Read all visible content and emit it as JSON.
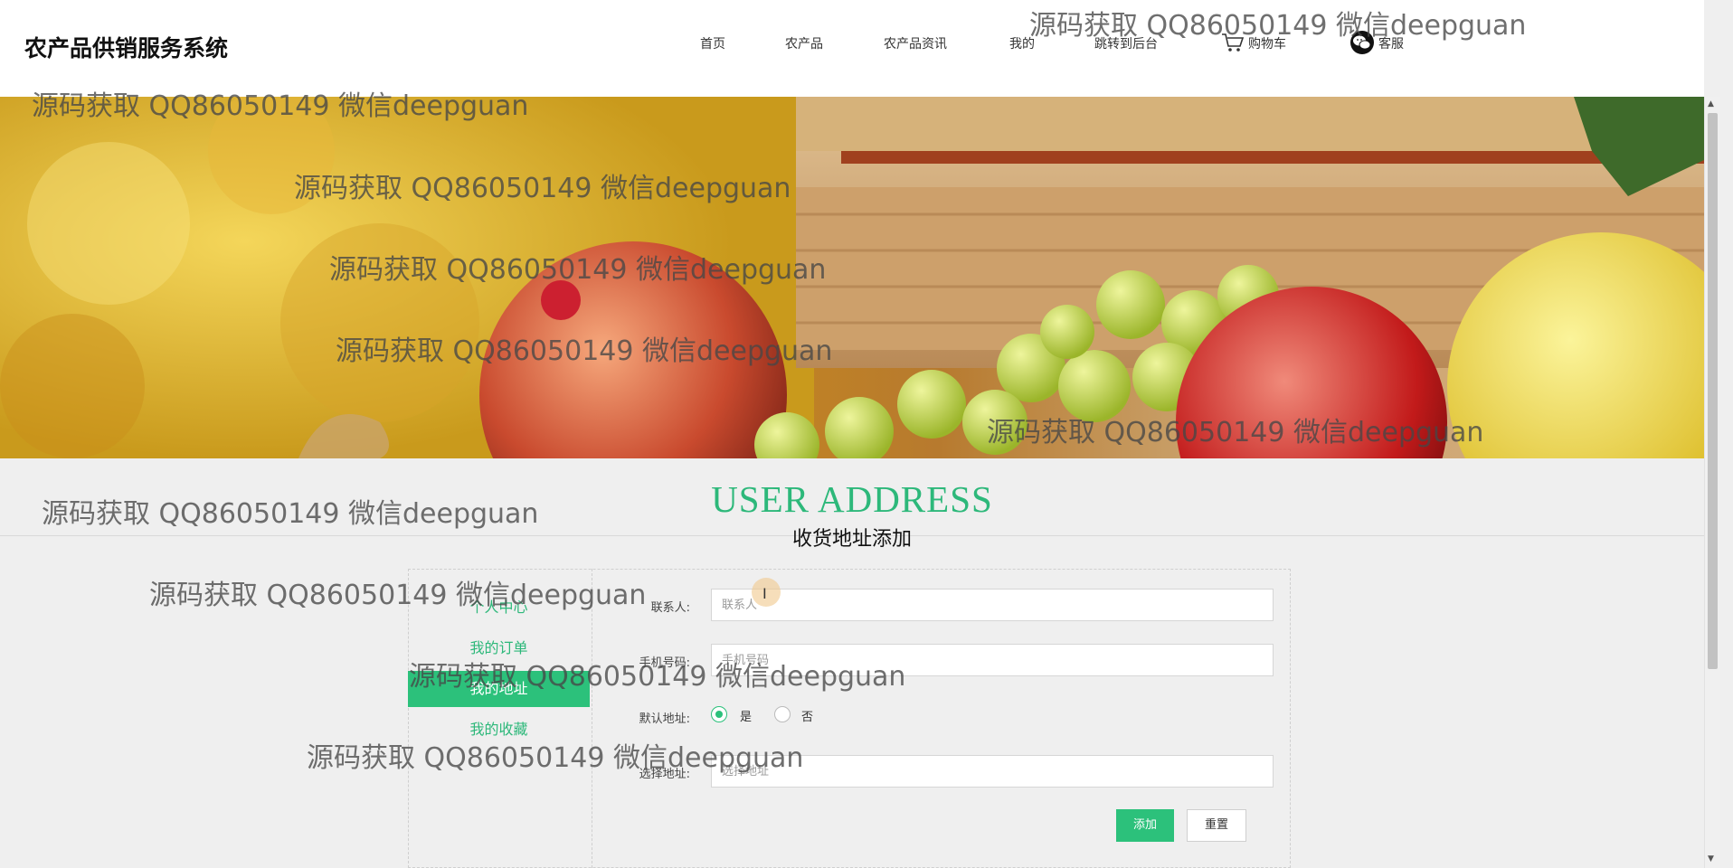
{
  "header": {
    "brand": "农产品供销服务系统",
    "nav": [
      {
        "label": "首页"
      },
      {
        "label": "农产品"
      },
      {
        "label": "农产品资讯"
      },
      {
        "label": "我的"
      },
      {
        "label": "跳转到后台"
      },
      {
        "label": "购物车",
        "icon": "cart-icon"
      },
      {
        "label": "客服",
        "icon": "wechat-icon"
      }
    ]
  },
  "section": {
    "title_en": "USER ADDRESS",
    "title_cn": "收货地址添加"
  },
  "sidebar": {
    "items": [
      {
        "label": "个人中心",
        "active": false
      },
      {
        "label": "我的订单",
        "active": false
      },
      {
        "label": "我的地址",
        "active": true
      },
      {
        "label": "我的收藏",
        "active": false
      }
    ]
  },
  "form": {
    "contact": {
      "label": "联系人:",
      "placeholder": "联系人",
      "value": ""
    },
    "phone": {
      "label": "手机号码:",
      "placeholder": "手机号码",
      "value": ""
    },
    "default": {
      "label": "默认地址:",
      "options": [
        "是",
        "否"
      ],
      "selected": "是"
    },
    "address": {
      "label": "选择地址:",
      "placeholder": "选择地址",
      "value": ""
    },
    "submit_label": "添加",
    "reset_label": "重置"
  },
  "watermark": "源码获取 QQ86050149 微信deepguan",
  "colors": {
    "accent": "#2cc17b",
    "title": "#2db87a",
    "background": "#efefef"
  }
}
